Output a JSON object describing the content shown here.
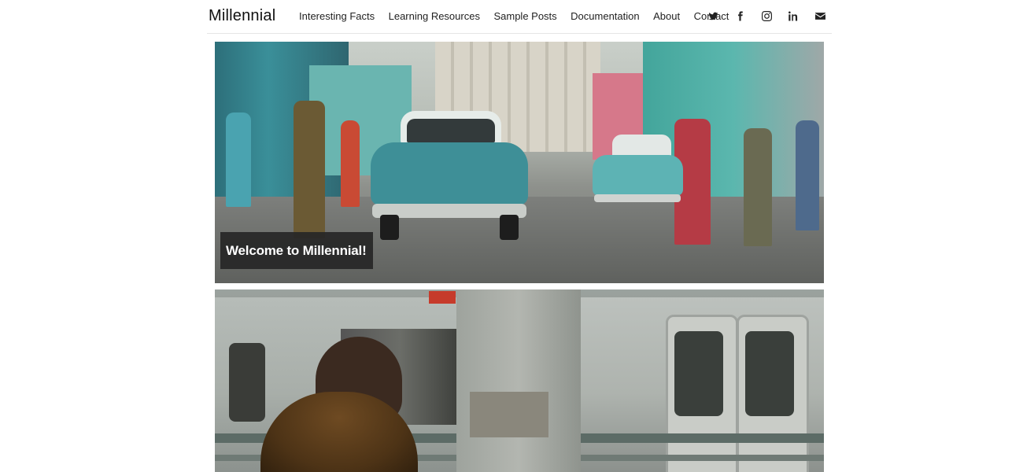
{
  "header": {
    "brand": "Millennial",
    "nav": [
      {
        "label": "Interesting Facts"
      },
      {
        "label": "Learning Resources"
      },
      {
        "label": "Sample Posts"
      },
      {
        "label": "Documentation"
      },
      {
        "label": "About"
      },
      {
        "label": "Contact"
      }
    ],
    "social": [
      {
        "icon": "twitter-icon"
      },
      {
        "icon": "facebook-icon"
      },
      {
        "icon": "instagram-icon"
      },
      {
        "icon": "linkedin-icon"
      },
      {
        "icon": "envelope-icon"
      }
    ]
  },
  "posts": [
    {
      "caption": "Welcome to Millennial!",
      "image": "street-scene-with-vintage-cars"
    },
    {
      "image": "subway-platform-with-moving-train"
    }
  ]
}
